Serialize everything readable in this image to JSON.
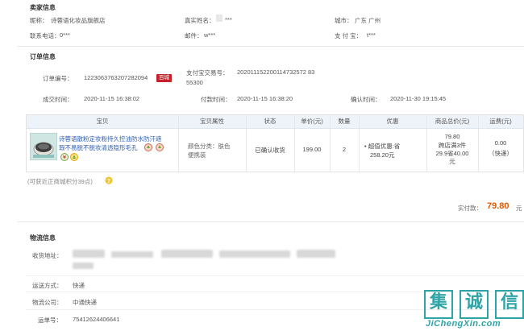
{
  "seller": {
    "title": "卖家信息",
    "nick_label": "昵称：",
    "nick_value": "诗蓉语化妆品旗舰店",
    "realname_label": "真实姓名：",
    "realname_value": "***",
    "city_label": "城市：",
    "city_value": "广东 广州",
    "phone_label": "联系电话：",
    "phone_value": "0***",
    "email_label": "邮件：",
    "email_value": "w***",
    "alipay_label": "支 付 宝：",
    "alipay_value": "t***"
  },
  "order": {
    "title": "订单信息",
    "number_label": "订单编号：",
    "number_value": "1223063763207282094",
    "number_badge": "百城",
    "alipay_trade_label": "支付宝交易号：",
    "alipay_trade_value_line1": "202011152200114732572 83",
    "alipay_trade_value_line2": "55300",
    "created_label": "成交时间：",
    "created_value": "2020-11-15 16:38:02",
    "paid_label": "付款时间：",
    "paid_value": "2020-11-15 16:38:20",
    "confirmed_label": "确认时间：",
    "confirmed_value": "2020-11-30 19:15:45"
  },
  "table": {
    "headers": [
      "宝贝",
      "宝贝属性",
      "状态",
      "单价(元)",
      "数量",
      "优惠",
      "商品总价(元)",
      "运费(元)"
    ],
    "item": {
      "title_line1": "诗蓉语散粉定妆粉持久控油防水防汗遮",
      "title_line2": "瑕不易脱不脱妆清透隐形毛孔",
      "attr_line1": "颜色分类：肤色",
      "attr_line2": "便携装",
      "status": "已确认收货",
      "unit_price": "199.00",
      "qty": "2",
      "discount_line1": "• 超值优惠:省",
      "discount_line2": "258.20元",
      "total_line1": "79.80",
      "total_line2": "跨店满3件",
      "total_line3": "29.9省40.00",
      "total_line4": "元",
      "shipping_line1": "0.00",
      "shipping_line2": "（快递）"
    }
  },
  "points_note": "(可获近正商城积分39点)",
  "paid": {
    "label": "实付款：",
    "amount": "79.80",
    "unit": "元"
  },
  "logistics": {
    "title": "物流信息",
    "address_label": "收货地址：",
    "method_label": "运送方式：",
    "method_value": "快递",
    "company_label": "物流公司：",
    "company_value": "中通快递",
    "tracking_label": "运单号：",
    "tracking_value": "75412624406641"
  },
  "watermark": {
    "chars": [
      "集",
      "诚",
      "信"
    ],
    "site": "JiChengXin.com"
  },
  "colors": {
    "accent_red": "#c8212a",
    "orange": "#e25a00",
    "link_blue": "#2f5fb0",
    "watermark_teal": "#2ea4a6"
  }
}
